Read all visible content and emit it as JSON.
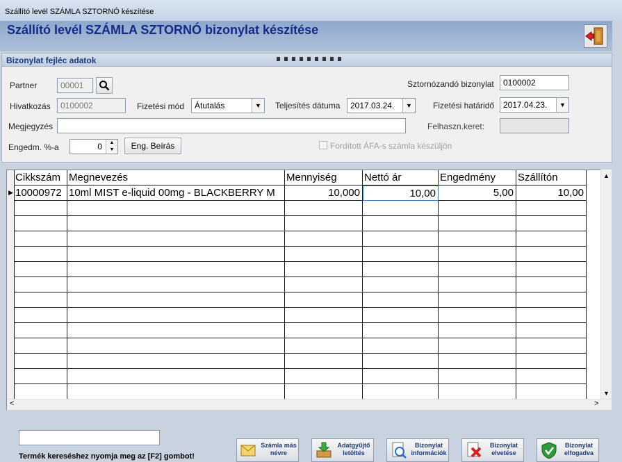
{
  "window": {
    "title": "Szállító levél SZÁMLA SZTORNÓ készítése"
  },
  "banner": {
    "title": "Szállító levél SZÁMLA SZTORNÓ bizonylat készítése"
  },
  "header_panel": {
    "title": "Bizonylat fejléc adatok",
    "partner_label": "Partner",
    "partner_value": "00001",
    "hivatkozas_label": "Hivatkozás",
    "hivatkozas_value": "0100002",
    "megjegyzes_label": "Megjegyzés",
    "megjegyzes_value": "",
    "engedm_label": "Engedm. %-a",
    "engedm_value": "0",
    "eng_beiras_label": "Eng. Beírás",
    "fizetesi_mod_label": "Fizetési mód",
    "fizetesi_mod_value": "Átutalás",
    "teljesites_label": "Teljesítés dátuma",
    "teljesites_value": "2017.03.24.",
    "sztornozando_label": "Sztornózandó bizonylat",
    "sztornozando_value": "0100002",
    "fizetesi_hatarido_label": "Fizetési határidő",
    "fizetesi_hatarido_value": "2017.04.23.",
    "felhaszn_keret_label": "Felhaszn.keret:",
    "felhaszn_keret_value": "",
    "forditott_afa_label": "Fordított ÁFA-s számla készüljön"
  },
  "grid": {
    "columns": [
      "Cikkszám",
      "Megnevezés",
      "Mennyiség",
      "Nettó ár",
      "Engedmény",
      "Szállítón"
    ],
    "rows": [
      [
        "10000972",
        "10ml MIST e-liquid 00mg - BLACKBERRY M",
        "10,000",
        "10,00",
        "5,00",
        "10,00"
      ]
    ],
    "scroll_left": "<",
    "scroll_right": ">",
    "scroll_up": "^",
    "scroll_down": "v"
  },
  "footer": {
    "search_value": "",
    "hint": "Termék kereséshez nyomja meg az [F2] gombot!",
    "buttons": [
      {
        "label": "Számla más névre",
        "icon": "envelope-icon"
      },
      {
        "label": "Adatgyűjtő letöltés",
        "icon": "download-icon"
      },
      {
        "label": "Bizonylat információk",
        "icon": "info-document-icon"
      },
      {
        "label": "Bizonylat elvetése",
        "icon": "reject-document-icon"
      },
      {
        "label": "Bizonylat elfogadva",
        "icon": "accept-shield-icon"
      }
    ]
  },
  "colors": {
    "accent": "#15298a",
    "banner": "#9fb4d4"
  }
}
